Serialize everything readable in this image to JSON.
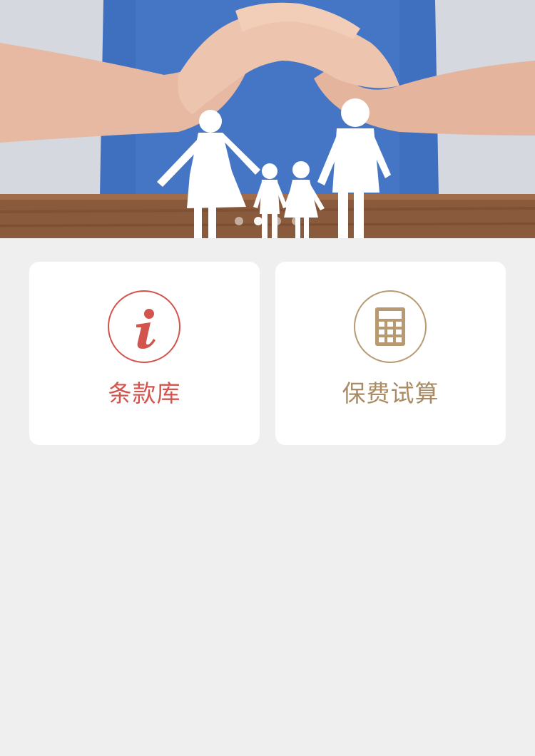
{
  "banner": {
    "image_description_icon": "family-protection-banner-image",
    "slides_count": 4,
    "active_slide": 2
  },
  "cards": [
    {
      "label": "条款库",
      "icon": "info-icon",
      "color": "#d2544c"
    },
    {
      "label": "保费试算",
      "icon": "calculator-icon",
      "color": "#a98b64"
    }
  ],
  "colors": {
    "background": "#efefef",
    "card_background": "#ffffff",
    "accent_red": "#d2544c",
    "accent_gold": "#a98b64"
  }
}
